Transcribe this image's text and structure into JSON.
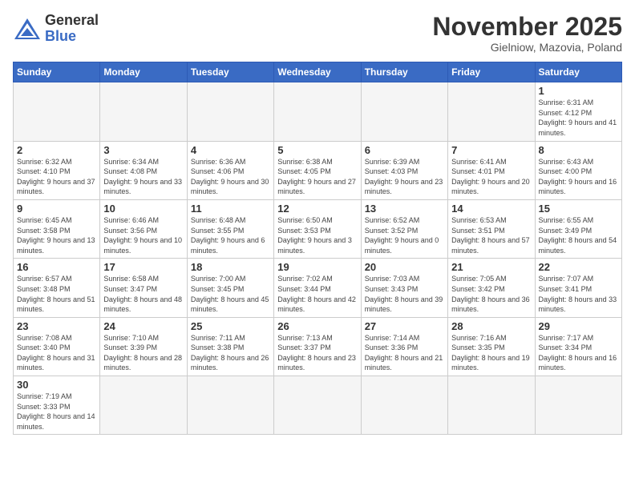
{
  "header": {
    "logo_general": "General",
    "logo_blue": "Blue",
    "month_title": "November 2025",
    "subtitle": "Gielniow, Mazovia, Poland"
  },
  "weekdays": [
    "Sunday",
    "Monday",
    "Tuesday",
    "Wednesday",
    "Thursday",
    "Friday",
    "Saturday"
  ],
  "weeks": [
    [
      {
        "day": "",
        "info": ""
      },
      {
        "day": "",
        "info": ""
      },
      {
        "day": "",
        "info": ""
      },
      {
        "day": "",
        "info": ""
      },
      {
        "day": "",
        "info": ""
      },
      {
        "day": "",
        "info": ""
      },
      {
        "day": "1",
        "info": "Sunrise: 6:31 AM\nSunset: 4:12 PM\nDaylight: 9 hours\nand 41 minutes."
      }
    ],
    [
      {
        "day": "2",
        "info": "Sunrise: 6:32 AM\nSunset: 4:10 PM\nDaylight: 9 hours\nand 37 minutes."
      },
      {
        "day": "3",
        "info": "Sunrise: 6:34 AM\nSunset: 4:08 PM\nDaylight: 9 hours\nand 33 minutes."
      },
      {
        "day": "4",
        "info": "Sunrise: 6:36 AM\nSunset: 4:06 PM\nDaylight: 9 hours\nand 30 minutes."
      },
      {
        "day": "5",
        "info": "Sunrise: 6:38 AM\nSunset: 4:05 PM\nDaylight: 9 hours\nand 27 minutes."
      },
      {
        "day": "6",
        "info": "Sunrise: 6:39 AM\nSunset: 4:03 PM\nDaylight: 9 hours\nand 23 minutes."
      },
      {
        "day": "7",
        "info": "Sunrise: 6:41 AM\nSunset: 4:01 PM\nDaylight: 9 hours\nand 20 minutes."
      },
      {
        "day": "8",
        "info": "Sunrise: 6:43 AM\nSunset: 4:00 PM\nDaylight: 9 hours\nand 16 minutes."
      }
    ],
    [
      {
        "day": "9",
        "info": "Sunrise: 6:45 AM\nSunset: 3:58 PM\nDaylight: 9 hours\nand 13 minutes."
      },
      {
        "day": "10",
        "info": "Sunrise: 6:46 AM\nSunset: 3:56 PM\nDaylight: 9 hours\nand 10 minutes."
      },
      {
        "day": "11",
        "info": "Sunrise: 6:48 AM\nSunset: 3:55 PM\nDaylight: 9 hours\nand 6 minutes."
      },
      {
        "day": "12",
        "info": "Sunrise: 6:50 AM\nSunset: 3:53 PM\nDaylight: 9 hours\nand 3 minutes."
      },
      {
        "day": "13",
        "info": "Sunrise: 6:52 AM\nSunset: 3:52 PM\nDaylight: 9 hours\nand 0 minutes."
      },
      {
        "day": "14",
        "info": "Sunrise: 6:53 AM\nSunset: 3:51 PM\nDaylight: 8 hours\nand 57 minutes."
      },
      {
        "day": "15",
        "info": "Sunrise: 6:55 AM\nSunset: 3:49 PM\nDaylight: 8 hours\nand 54 minutes."
      }
    ],
    [
      {
        "day": "16",
        "info": "Sunrise: 6:57 AM\nSunset: 3:48 PM\nDaylight: 8 hours\nand 51 minutes."
      },
      {
        "day": "17",
        "info": "Sunrise: 6:58 AM\nSunset: 3:47 PM\nDaylight: 8 hours\nand 48 minutes."
      },
      {
        "day": "18",
        "info": "Sunrise: 7:00 AM\nSunset: 3:45 PM\nDaylight: 8 hours\nand 45 minutes."
      },
      {
        "day": "19",
        "info": "Sunrise: 7:02 AM\nSunset: 3:44 PM\nDaylight: 8 hours\nand 42 minutes."
      },
      {
        "day": "20",
        "info": "Sunrise: 7:03 AM\nSunset: 3:43 PM\nDaylight: 8 hours\nand 39 minutes."
      },
      {
        "day": "21",
        "info": "Sunrise: 7:05 AM\nSunset: 3:42 PM\nDaylight: 8 hours\nand 36 minutes."
      },
      {
        "day": "22",
        "info": "Sunrise: 7:07 AM\nSunset: 3:41 PM\nDaylight: 8 hours\nand 33 minutes."
      }
    ],
    [
      {
        "day": "23",
        "info": "Sunrise: 7:08 AM\nSunset: 3:40 PM\nDaylight: 8 hours\nand 31 minutes."
      },
      {
        "day": "24",
        "info": "Sunrise: 7:10 AM\nSunset: 3:39 PM\nDaylight: 8 hours\nand 28 minutes."
      },
      {
        "day": "25",
        "info": "Sunrise: 7:11 AM\nSunset: 3:38 PM\nDaylight: 8 hours\nand 26 minutes."
      },
      {
        "day": "26",
        "info": "Sunrise: 7:13 AM\nSunset: 3:37 PM\nDaylight: 8 hours\nand 23 minutes."
      },
      {
        "day": "27",
        "info": "Sunrise: 7:14 AM\nSunset: 3:36 PM\nDaylight: 8 hours\nand 21 minutes."
      },
      {
        "day": "28",
        "info": "Sunrise: 7:16 AM\nSunset: 3:35 PM\nDaylight: 8 hours\nand 19 minutes."
      },
      {
        "day": "29",
        "info": "Sunrise: 7:17 AM\nSunset: 3:34 PM\nDaylight: 8 hours\nand 16 minutes."
      }
    ],
    [
      {
        "day": "30",
        "info": "Sunrise: 7:19 AM\nSunset: 3:33 PM\nDaylight: 8 hours\nand 14 minutes."
      },
      {
        "day": "",
        "info": ""
      },
      {
        "day": "",
        "info": ""
      },
      {
        "day": "",
        "info": ""
      },
      {
        "day": "",
        "info": ""
      },
      {
        "day": "",
        "info": ""
      },
      {
        "day": "",
        "info": ""
      }
    ]
  ]
}
